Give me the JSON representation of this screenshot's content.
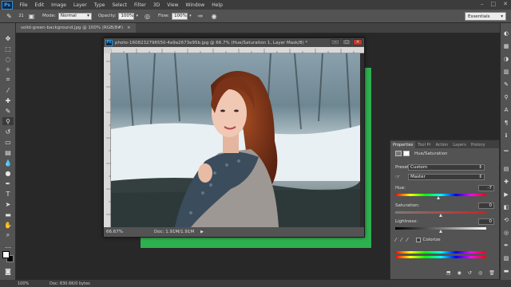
{
  "menubar": {
    "logo": "Ps",
    "items": [
      "File",
      "Edit",
      "Image",
      "Layer",
      "Type",
      "Select",
      "Filter",
      "3D",
      "View",
      "Window",
      "Help"
    ]
  },
  "options": {
    "mode_label": "Mode:",
    "mode_value": "Normal",
    "opacity_label": "Opacity:",
    "opacity_value": "100%",
    "flow_label": "Flow:",
    "flow_value": "100%",
    "brush_size": "21",
    "workspace": "Essentials"
  },
  "document": {
    "tab_title": "solid-green-background.jpg @ 100% (RGB/8#)",
    "window_title": "photo-1608232796550-4a9a2673e95b.jpg @ 66.7% (Hue/Saturation 1, Layer Mask/8) *",
    "zoom": "66.67%",
    "doc_info": "Doc: 1.91M/1.91M"
  },
  "properties": {
    "tabs": [
      "Properties",
      "Tool Pr",
      "Action",
      "Layers",
      "History"
    ],
    "panel_title": "Hue/Saturation",
    "preset_label": "Preset:",
    "preset_value": "Custom",
    "channel_value": "Master",
    "hue_label": "Hue:",
    "hue_value": "-7",
    "hue_level": 0.48,
    "saturation_label": "Saturation:",
    "saturation_value": "0",
    "lightness_label": "Lightness:",
    "lightness_value": "0",
    "colorize_label": "Colorize"
  },
  "status": {
    "zoom": "100%",
    "doc_info": "Doc: 830.6K/0 bytes"
  },
  "colors": {
    "green_canvas": "#2db04f",
    "ps_blue": "#3fa9f5"
  }
}
